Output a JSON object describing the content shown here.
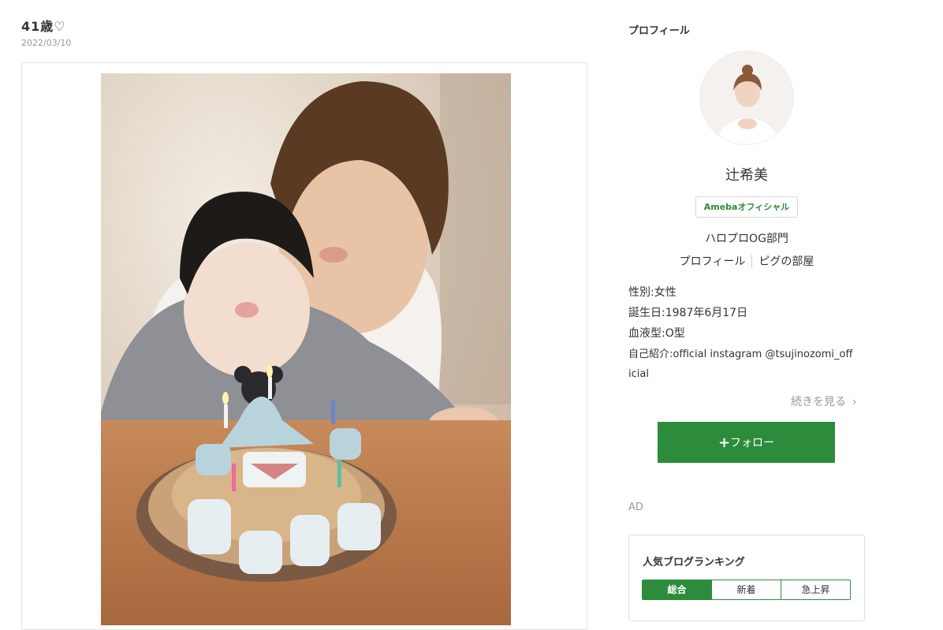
{
  "post": {
    "title": "41歳♡",
    "date": "2022/03/10"
  },
  "sidebar": {
    "profile_heading": "プロフィール",
    "name": "辻希美",
    "official_badge": "Amebaオフィシャル",
    "genre": "ハロプロOG部門",
    "profile_link": "プロフィール",
    "room_link": "ピグの部屋",
    "gender": "性別:女性",
    "birthday": "誕生日:1987年6月17日",
    "blood_type": "血液型:O型",
    "intro_line1": "自己紹介:official instagram @tsujinozomi_off",
    "intro_line2": "icial",
    "more_label": "続きを見る",
    "follow_button": "フォロー",
    "ad_label": "AD"
  },
  "ranking": {
    "title": "人気ブログランキング",
    "tabs": [
      "総合",
      "新着",
      "急上昇"
    ],
    "active_tab": "総合"
  },
  "colors": {
    "accent_green": "#2d8c3c",
    "text": "#333333",
    "muted": "#999999"
  },
  "icons": {
    "follow": "plus-icon",
    "more": "chevron-right-icon"
  }
}
